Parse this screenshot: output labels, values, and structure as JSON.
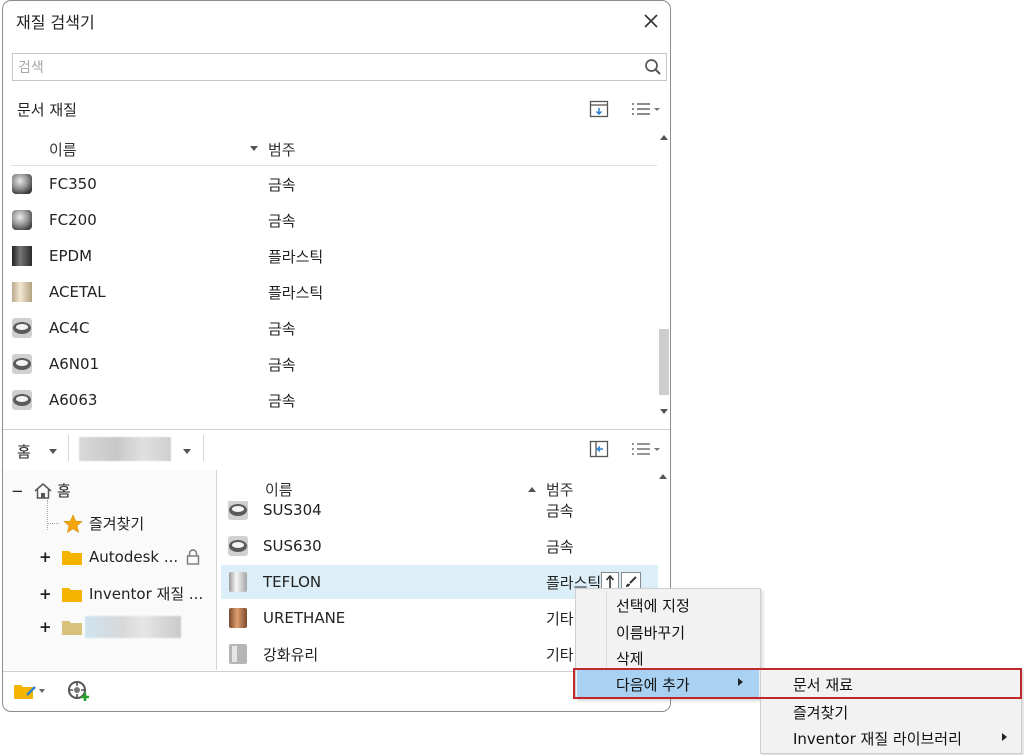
{
  "window": {
    "title": "재질 검색기"
  },
  "search": {
    "placeholder": "검색"
  },
  "doc_section": {
    "label": "문서 재질",
    "headers": {
      "name": "이름",
      "category": "범주"
    },
    "rows": [
      {
        "name": "FC350",
        "category": "금속",
        "icon": "metal-sphere-icon"
      },
      {
        "name": "FC200",
        "category": "금속",
        "icon": "metal-sphere-icon"
      },
      {
        "name": "EPDM",
        "category": "플라스틱",
        "icon": "dark-cylinder-icon"
      },
      {
        "name": "ACETAL",
        "category": "플라스틱",
        "icon": "beige-cylinder-icon"
      },
      {
        "name": "AC4C",
        "category": "금속",
        "icon": "metal-disc-icon"
      },
      {
        "name": "A6N01",
        "category": "금속",
        "icon": "metal-disc-icon"
      },
      {
        "name": "A6063",
        "category": "금속",
        "icon": "metal-disc-icon"
      }
    ]
  },
  "library": {
    "home_label": "홈",
    "tree": {
      "home": "홈",
      "favorites": "즐겨찾기",
      "autodesk": "Autodesk ...",
      "inventor": "Inventor 재질 ..."
    },
    "headers": {
      "name": "이름",
      "category": "범주"
    },
    "rows": [
      {
        "name": "SUS304",
        "category": "금속"
      },
      {
        "name": "SUS630",
        "category": "금속"
      },
      {
        "name": "TEFLON",
        "category": "플라스틱"
      },
      {
        "name": "URETHANE",
        "category": "기타"
      },
      {
        "name": "강화유리",
        "category": "기타"
      }
    ]
  },
  "context_menu": {
    "items": [
      "선택에 지정",
      "이름바꾸기",
      "삭제",
      "다음에 추가"
    ]
  },
  "submenu": {
    "items": [
      "문서 재료",
      "즐겨찾기",
      "Inventor 재질 라이브러리"
    ]
  },
  "colors": {
    "selection": "#dceef7",
    "menu_highlight": "#a9d2f2",
    "folder": "#f5b400",
    "highlight_box": "#c0282d"
  }
}
